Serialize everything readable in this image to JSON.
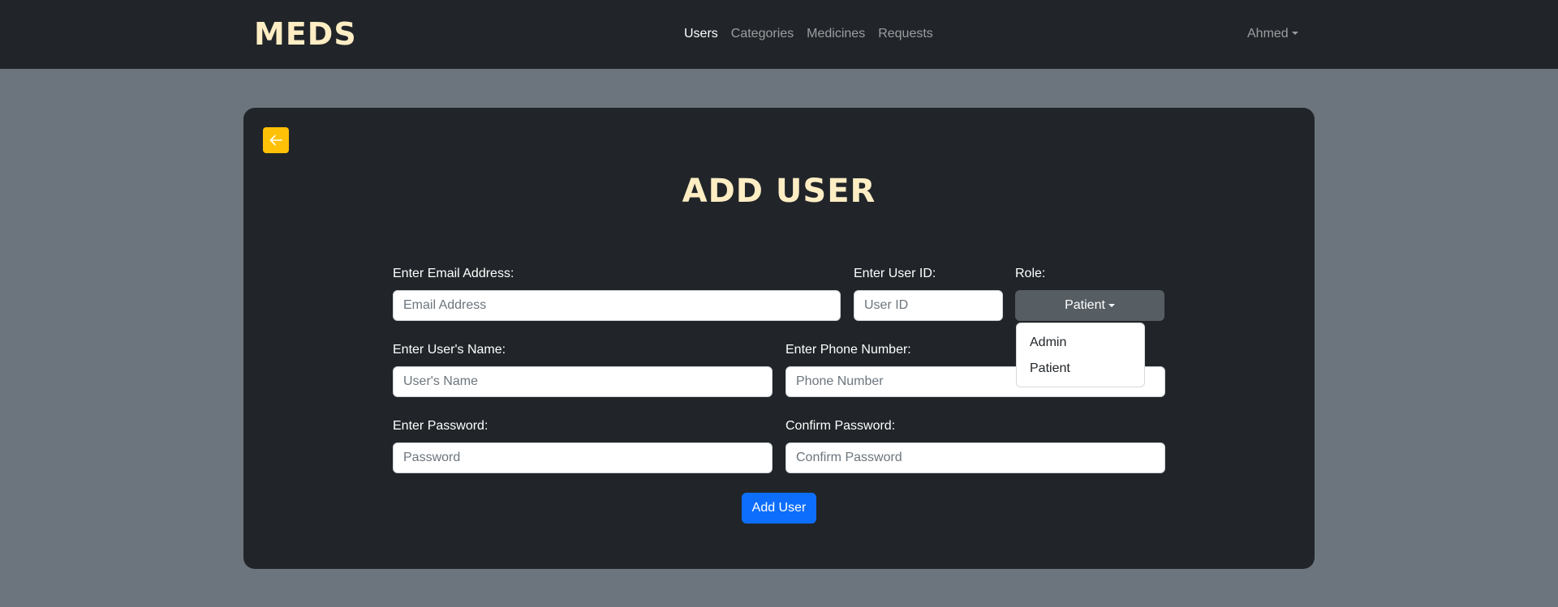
{
  "navbar": {
    "brand": "MEDS",
    "links": [
      {
        "label": "Users",
        "active": true
      },
      {
        "label": "Categories",
        "active": false
      },
      {
        "label": "Medicines",
        "active": false
      },
      {
        "label": "Requests",
        "active": false
      }
    ],
    "user": "Ahmed"
  },
  "page": {
    "back_icon": "arrow-left-icon",
    "title": "ADD USER"
  },
  "form": {
    "email": {
      "label": "Enter Email Address:",
      "placeholder": "Email Address",
      "value": ""
    },
    "user_id": {
      "label": "Enter User ID:",
      "placeholder": "User ID",
      "value": ""
    },
    "role": {
      "label": "Role:",
      "selected": "Patient",
      "options": [
        "Admin",
        "Patient"
      ]
    },
    "name": {
      "label": "Enter User's Name:",
      "placeholder": "User's Name",
      "value": ""
    },
    "phone": {
      "label": "Enter Phone Number:",
      "placeholder": "Phone Number",
      "value": ""
    },
    "password": {
      "label": "Enter Password:",
      "placeholder": "Password",
      "value": ""
    },
    "confirm_password": {
      "label": "Confirm Password:",
      "placeholder": "Confirm Password",
      "value": ""
    },
    "submit_label": "Add User"
  },
  "colors": {
    "page_bg": "#6c757d",
    "navbar_bg": "#212529",
    "card_bg": "#212529",
    "brand": "#ffedc4",
    "back_button": "#ffc107",
    "primary": "#0d6efd",
    "secondary": "#565e64"
  }
}
